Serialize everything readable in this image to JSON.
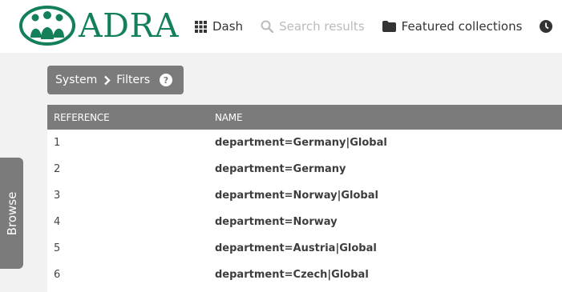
{
  "header": {
    "logo_text": "ADRA",
    "nav": [
      {
        "label": "Dash",
        "icon": "grid-icon",
        "disabled": false
      },
      {
        "label": "Search results",
        "icon": "search-icon",
        "disabled": true
      },
      {
        "label": "Featured collections",
        "icon": "folder-icon",
        "disabled": false
      }
    ],
    "next_icon": "clock-icon"
  },
  "breadcrumb": {
    "items": [
      "System",
      "Filters"
    ],
    "separator_icon": "chevron-right-icon",
    "help_icon": "help-circle-icon"
  },
  "table": {
    "columns": [
      "REFERENCE",
      "NAME"
    ],
    "rows": [
      {
        "reference": "1",
        "name": "department=Germany|Global"
      },
      {
        "reference": "2",
        "name": "department=Germany"
      },
      {
        "reference": "3",
        "name": "department=Norway|Global"
      },
      {
        "reference": "4",
        "name": "department=Norway"
      },
      {
        "reference": "5",
        "name": "department=Austria|Global"
      },
      {
        "reference": "6",
        "name": "department=Czech|Global"
      }
    ]
  },
  "browse_tab": {
    "label": "Browse"
  },
  "colors": {
    "brand": "#14805a",
    "bar": "#7b7b7b",
    "background": "#f2f2f2"
  }
}
